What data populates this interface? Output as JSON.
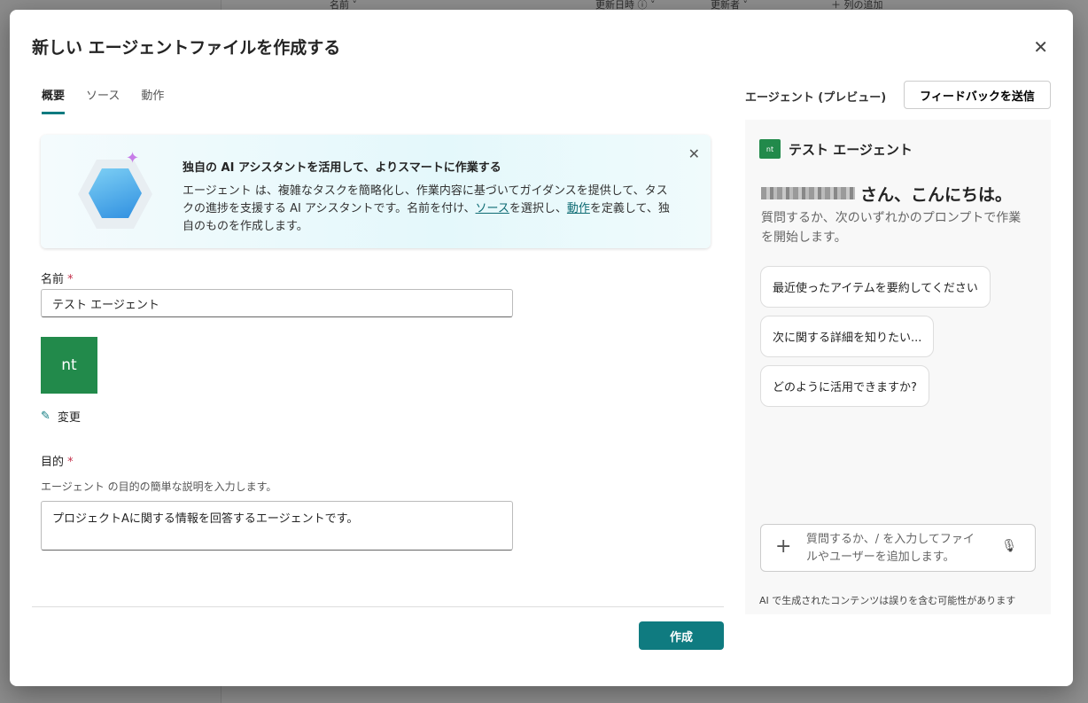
{
  "background": {
    "columns": [
      "名前 ˅",
      "更新日時 ⓘ ˅",
      "更新者 ˅",
      "＋ 列の追加"
    ]
  },
  "dialog": {
    "title": "新しい エージェントファイルを作成する",
    "close_icon": "✕",
    "tabs": [
      {
        "label": "概要"
      },
      {
        "label": "ソース"
      },
      {
        "label": "動作"
      }
    ],
    "banner": {
      "title": "独自の AI アシスタントを活用して、よりスマートに作業する",
      "body_before": "エージェント は、複雑なタスクを簡略化し、作業内容に基づいてガイダンスを提供して、タスクの進捗を支援する AI アシスタントです。名前を付け、",
      "link_source": "ソース",
      "body_mid": "を選択し、",
      "link_action": "動作",
      "body_after": "を定義して、独自のものを作成します。"
    },
    "name": {
      "label": "名前",
      "required": "*",
      "value": "テスト エージェント"
    },
    "avatar": {
      "initials": "nt",
      "change_label": "変更"
    },
    "purpose": {
      "label": "目的",
      "required": "*",
      "hint": "エージェント の目的の簡単な説明を入力します。",
      "value": "プロジェクトAに関する情報を回答するエージェントです。"
    },
    "create_label": "作成"
  },
  "preview": {
    "heading": "エージェント (プレビュー)",
    "feedback_label": "フィードバックを送信",
    "agent_initials": "nt",
    "agent_name": "テスト エージェント",
    "greeting": "さん、こんにちは。",
    "subtitle": "質問するか、次のいずれかのプロンプトで作業を開始します。",
    "prompts": [
      "最近使ったアイテムを要約してください",
      "次に関する詳細を知りたい...",
      "どのように活用できますか?"
    ],
    "chat_placeholder": "質問するか、/ を入力してファイルやユーザーを追加します。",
    "disclaimer": "AI で生成されたコンテンツは誤りを含む可能性があります"
  },
  "colors": {
    "accent": "#0f7b80",
    "avatar": "#228a4b"
  }
}
